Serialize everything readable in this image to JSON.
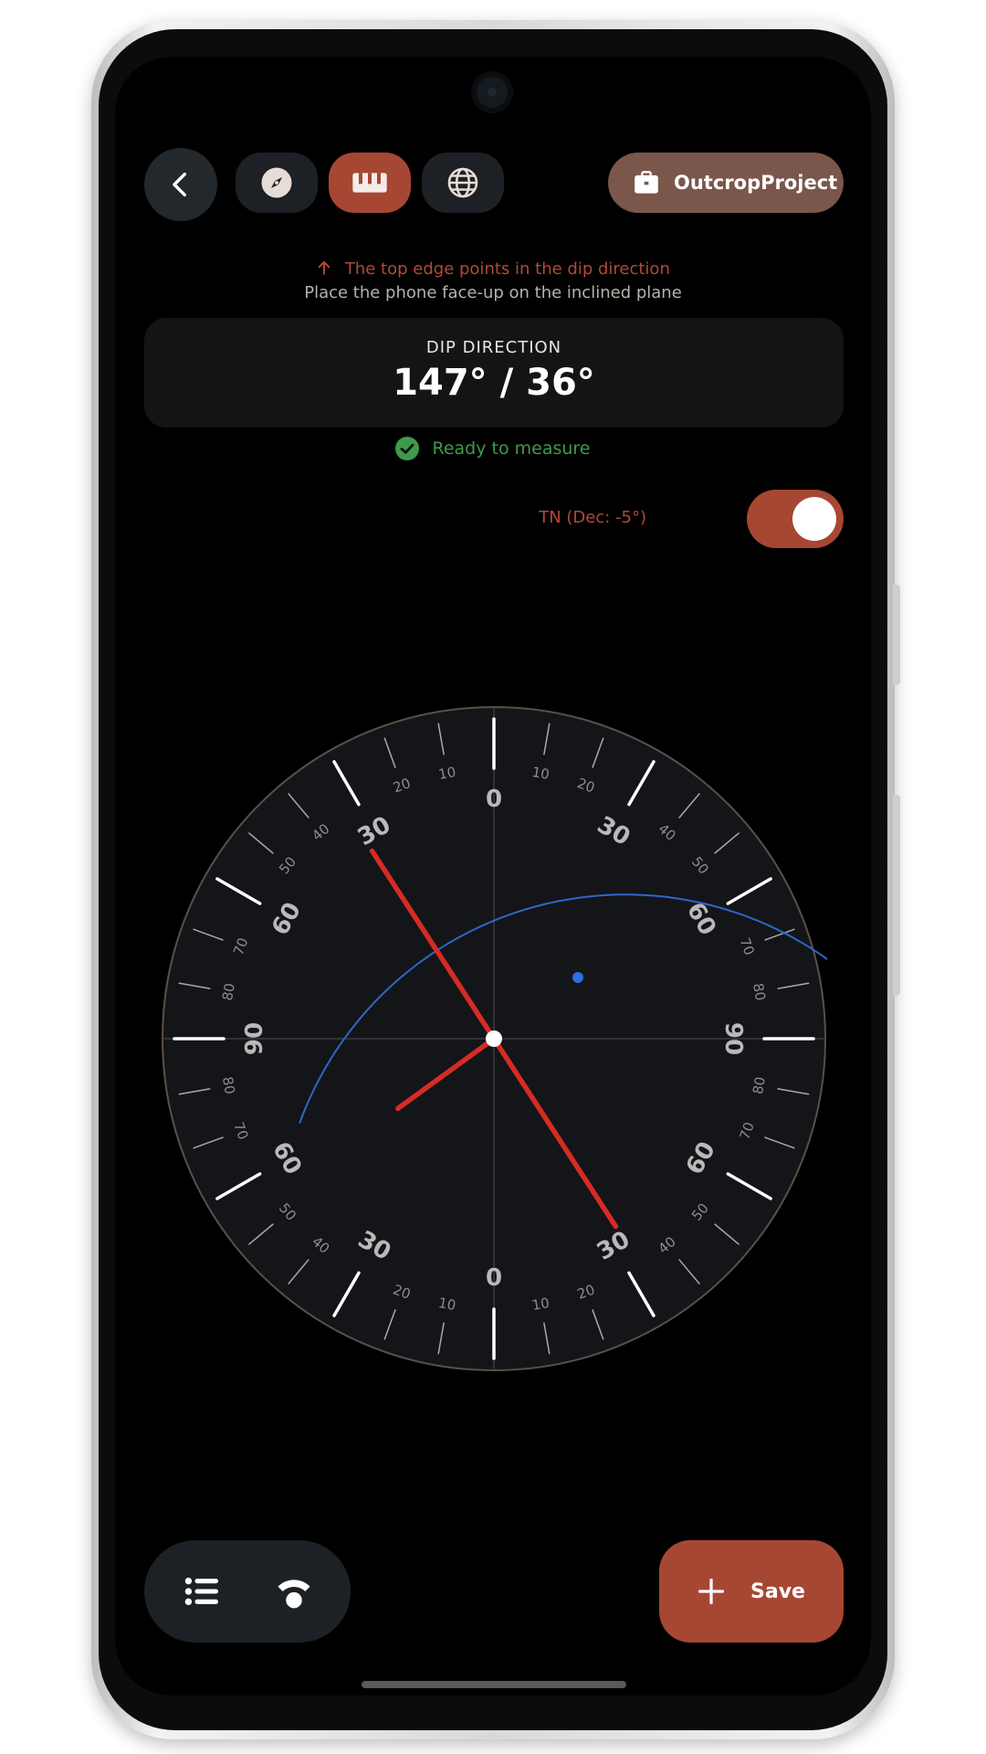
{
  "header": {
    "project_name": "OutcropProject",
    "modes": [
      {
        "icon": "compass-icon",
        "active": false
      },
      {
        "icon": "ruler-icon",
        "active": true
      },
      {
        "icon": "globe-icon",
        "active": false
      }
    ]
  },
  "instructions": {
    "line1": "The top edge points in the dip direction",
    "line2": "Place the phone face-up on the inclined plane"
  },
  "reading": {
    "label": "DIP DIRECTION",
    "value": "147° / 36°"
  },
  "status": {
    "text": "Ready to measure"
  },
  "north_toggle": {
    "label": "TN (Dec: -5°)",
    "on": true
  },
  "clinometer": {
    "major_labels": [
      "0",
      "30",
      "60",
      "90"
    ],
    "minor_labels": [
      "10",
      "20",
      "40",
      "50",
      "70",
      "80"
    ],
    "long_needle_bearing_deg": 147,
    "short_needle_bearing_deg": 234,
    "dip_deg": 36,
    "colors": {
      "needle": "#d62b24",
      "great_circle": "#2f66c8",
      "pole_dot": "#2f6fe0",
      "dial": "#131518"
    }
  },
  "bottom_bar": {
    "list_icon": "list-icon",
    "signal_icon": "signal-icon",
    "save_label": "Save"
  }
}
